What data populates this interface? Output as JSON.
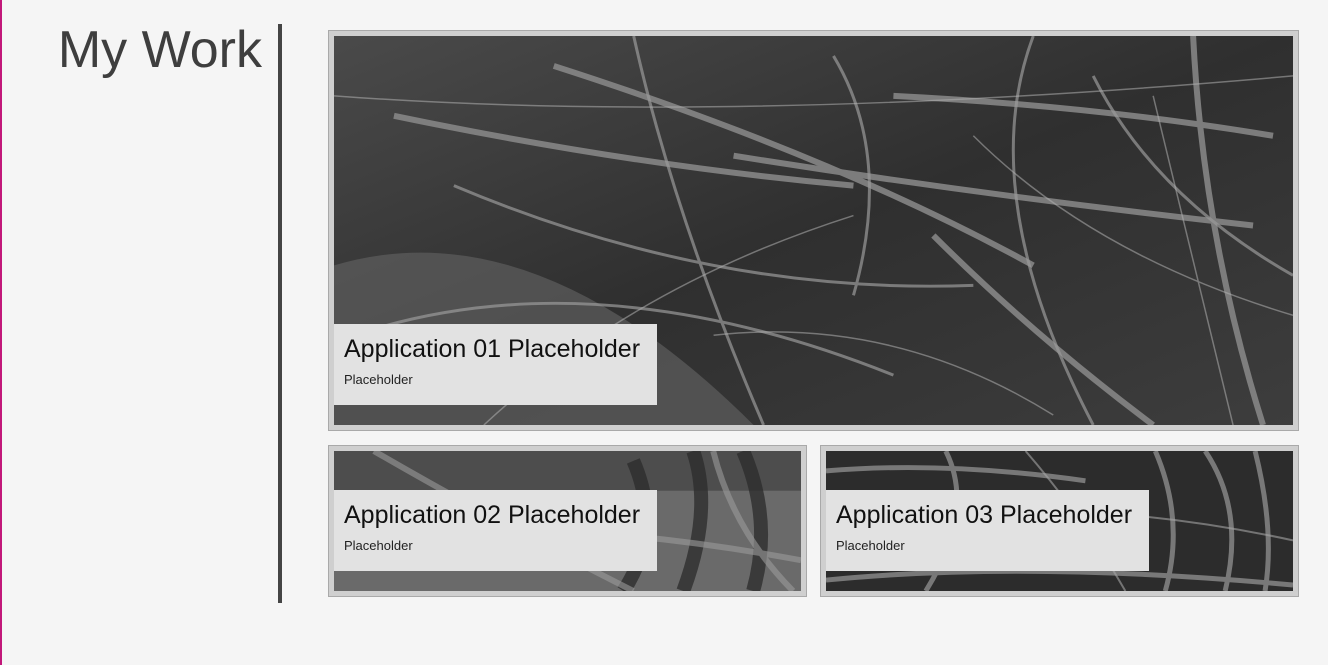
{
  "page": {
    "title": "My Work"
  },
  "colors": {
    "background": "#f5f5f5",
    "divider": "#444444",
    "caption_bg": "#e2e2e2",
    "left_edge_accent": "#c2187a"
  },
  "cards": [
    {
      "title": "Application 01 Placeholder",
      "subtitle": "Placeholder",
      "image": "frosted-branches-photo"
    },
    {
      "title": "Application 02 Placeholder",
      "subtitle": "Placeholder",
      "image": "frosted-branches-photo"
    },
    {
      "title": "Application 03 Placeholder",
      "subtitle": "Placeholder",
      "image": "frosted-branches-photo"
    }
  ]
}
